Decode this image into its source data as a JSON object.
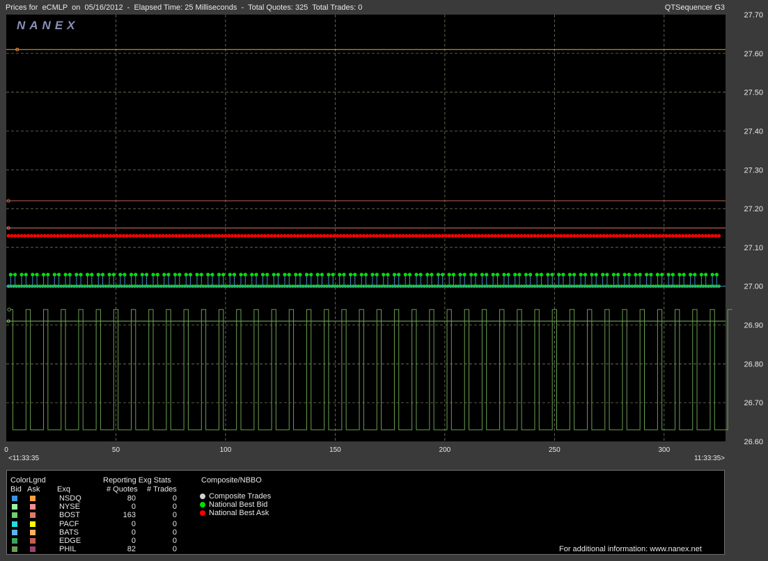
{
  "header": {
    "title": "Prices for  eCMLP  on  05/16/2012  -  Elapsed Time: 25 Milliseconds  -  Total Quotes: 325  Total Trades: 0",
    "app": "QTSequencer G3"
  },
  "logo_text": "NANEX",
  "chart_data": {
    "type": "line",
    "title": "",
    "xlabel": "",
    "ylabel": "",
    "xlim": [
      0,
      328
    ],
    "ylim": [
      26.6,
      27.7
    ],
    "grid": true,
    "x_ticks": [
      "0",
      "50",
      "100",
      "150",
      "200",
      "250",
      "300"
    ],
    "x_tick_values": [
      0,
      50,
      100,
      150,
      200,
      250,
      300
    ],
    "y_ticks": [
      "27.70",
      "27.60",
      "27.50",
      "27.40",
      "27.30",
      "27.20",
      "27.10",
      "27.00",
      "26.90",
      "26.80",
      "26.70",
      "26.60"
    ],
    "y_tick_values": [
      27.7,
      27.6,
      27.5,
      27.4,
      27.3,
      27.2,
      27.1,
      27.0,
      26.9,
      26.8,
      26.7,
      26.6
    ],
    "x_start_label": "<11:33:35",
    "x_end_label": "11:33:35>",
    "series": [
      {
        "name": "NSDQ Ask",
        "color": "#ffa040",
        "style": "line",
        "y": 27.61
      },
      {
        "name": "EDGE Ask",
        "color": "#c06050",
        "style": "line",
        "y": 27.22
      },
      {
        "name": "BOST Ask",
        "color": "#e07a6a",
        "style": "line",
        "y": 27.15
      },
      {
        "name": "National Best Ask",
        "color": "#ff0000",
        "style": "dots",
        "y": 27.13
      },
      {
        "name": "National Best Bid",
        "color": "#00e000",
        "style": "flicker",
        "low": 27.0,
        "high": 27.03
      },
      {
        "name": "NSDQ Bid",
        "color": "#4a8cd0",
        "style": "line",
        "y": 27.0
      },
      {
        "name": "BOST Bid",
        "color": "#80c060",
        "style": "line",
        "y": 26.91
      },
      {
        "name": "PHIL Bid",
        "color": "#6aa050",
        "style": "square-wave",
        "low": 26.63,
        "high": 26.94
      }
    ]
  },
  "legend": {
    "colorlgnd_title": "ColorLgnd",
    "bid_label": "Bid",
    "ask_label": "Ask",
    "exq_label": "Exq",
    "stats_title": "Reporting Exg Stats",
    "quotes_header": "# Quotes",
    "trades_header": "# Trades",
    "composite_title": "Composite/NBBO",
    "rows": [
      {
        "exq": "NSDQ",
        "quotes": "80",
        "trades": "0",
        "bid_color": "#3a90e0",
        "ask_color": "#ffa040"
      },
      {
        "exq": "NYSE",
        "quotes": "0",
        "trades": "0",
        "bid_color": "#a0f0a0",
        "ask_color": "#f09090"
      },
      {
        "exq": "BOST",
        "quotes": "163",
        "trades": "0",
        "bid_color": "#70d070",
        "ask_color": "#e07a6a"
      },
      {
        "exq": "PACF",
        "quotes": "0",
        "trades": "0",
        "bid_color": "#20e0e0",
        "ask_color": "#ffff00"
      },
      {
        "exq": "BATS",
        "quotes": "0",
        "trades": "0",
        "bid_color": "#60b0f0",
        "ask_color": "#ffb060"
      },
      {
        "exq": "EDGE",
        "quotes": "0",
        "trades": "0",
        "bid_color": "#40a060",
        "ask_color": "#c06050"
      },
      {
        "exq": "PHIL",
        "quotes": "82",
        "trades": "0",
        "bid_color": "#6aa050",
        "ask_color": "#a04070"
      }
    ],
    "composite_items": [
      {
        "label": "Composite Trades",
        "color": "#d0d0d0"
      },
      {
        "label": "National Best Bid",
        "color": "#00e000"
      },
      {
        "label": "National Best Ask",
        "color": "#ff0000"
      }
    ],
    "footer": "For additional information: www.nanex.net"
  }
}
